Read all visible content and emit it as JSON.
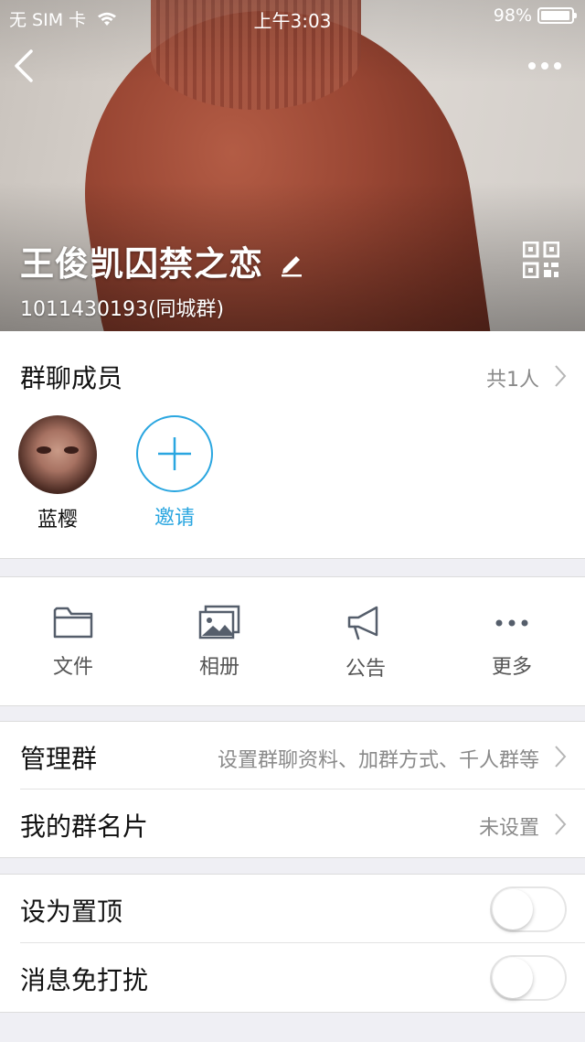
{
  "status_bar": {
    "carrier": "无 SIM 卡",
    "time": "上午3:03",
    "battery": "98%",
    "battery_level": 0.98
  },
  "header": {
    "group_name": "王俊凯囚禁之恋",
    "group_id": "1011430193(同城群)"
  },
  "members": {
    "label": "群聊成员",
    "count": "共1人",
    "list": [
      {
        "name": "蓝樱"
      }
    ],
    "invite_label": "邀请"
  },
  "tools": [
    {
      "label": "文件",
      "icon": "folder-icon"
    },
    {
      "label": "相册",
      "icon": "album-icon"
    },
    {
      "label": "公告",
      "icon": "megaphone-icon"
    },
    {
      "label": "更多",
      "icon": "more-icon"
    }
  ],
  "manage": {
    "label": "管理群",
    "value": "设置群聊资料、加群方式、千人群等"
  },
  "card": {
    "label": "我的群名片",
    "value": "未设置"
  },
  "pin": {
    "label": "设为置顶",
    "on": false
  },
  "mute": {
    "label": "消息免打扰",
    "on": false
  },
  "colors": {
    "accent": "#2aa6e0",
    "background": "#efeff4"
  }
}
